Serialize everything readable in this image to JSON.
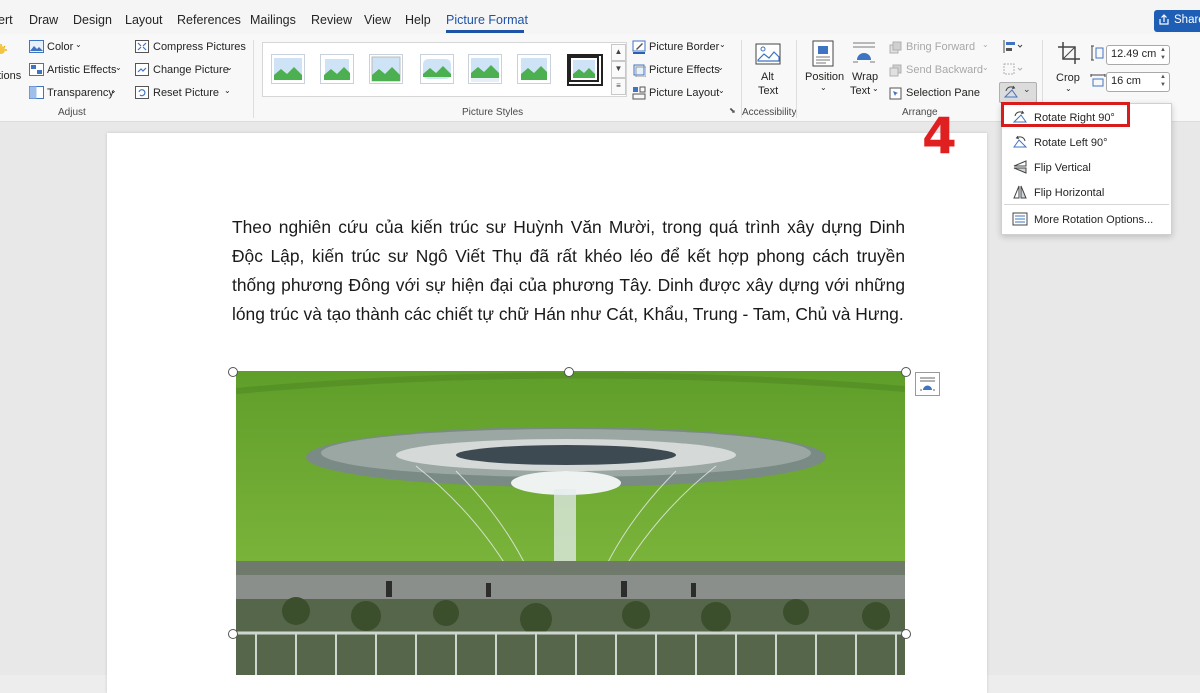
{
  "menu_tabs": [
    {
      "label": "ert",
      "active": false
    },
    {
      "label": "Draw",
      "active": false
    },
    {
      "label": "Design",
      "active": false
    },
    {
      "label": "Layout",
      "active": false
    },
    {
      "label": "References",
      "active": false
    },
    {
      "label": "Mailings",
      "active": false
    },
    {
      "label": "Review",
      "active": false
    },
    {
      "label": "View",
      "active": false
    },
    {
      "label": "Help",
      "active": false
    },
    {
      "label": "Picture Format",
      "active": true
    }
  ],
  "share_label": "Share",
  "ribbon": {
    "adjust": {
      "partial_label": "tions",
      "color": "Color",
      "artistic_effects": "Artistic Effects",
      "transparency": "Transparency",
      "compress": "Compress Pictures",
      "change": "Change Picture",
      "reset": "Reset Picture",
      "group": "Adjust"
    },
    "styles": {
      "border": "Picture Border",
      "effects": "Picture Effects",
      "layout": "Picture Layout",
      "group": "Picture Styles"
    },
    "accessibility": {
      "alt_line1": "Alt",
      "alt_line2": "Text",
      "group": "Accessibility"
    },
    "arrange": {
      "position": "Position",
      "wrap_line1": "Wrap",
      "wrap_line2": "Text",
      "bring_forward": "Bring Forward",
      "send_backward": "Send Backward",
      "selection_pane": "Selection Pane",
      "group": "Arrange"
    },
    "size": {
      "crop": "Crop",
      "height": "12.49 cm",
      "width": "16 cm"
    }
  },
  "rotate_menu": {
    "items": [
      {
        "label": "Rotate Right 90°",
        "icon": "rotate-right-icon"
      },
      {
        "label": "Rotate Left 90°",
        "icon": "rotate-left-icon"
      },
      {
        "label": "Flip Vertical",
        "icon": "flip-vertical-icon"
      },
      {
        "label": "Flip Horizontal",
        "icon": "flip-horizontal-icon"
      },
      {
        "label": "More Rotation Options...",
        "icon": "more-rotation-icon"
      }
    ]
  },
  "annotation": {
    "step": "4",
    "color": "#d81c1c"
  },
  "document": {
    "paragraph": "Theo nghiên cứu của kiến trúc sư Huỳnh Văn Mười, trong quá trình xây dựng Dinh Độc Lập, kiến trúc sư Ngô Viết Thụ đã rất khéo léo để kết hợp phong cách truyền thống phương Đông với sự hiện đại của phương Tây. Dinh được xây dựng với những lóng trúc và tạo thành các chiết tự chữ Hán như Cát, Khẩu, Trung - Tam, Chủ và Hưng."
  },
  "colors": {
    "accent": "#1e53a6",
    "share": "#1f5eb5",
    "highlight": "#d81c1c"
  }
}
